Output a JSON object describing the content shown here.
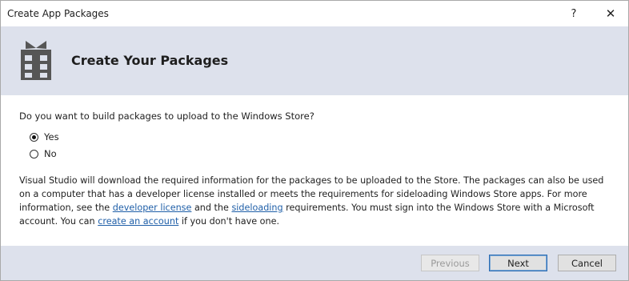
{
  "window": {
    "title": "Create App Packages",
    "help_label": "?",
    "close_label": "✕"
  },
  "header": {
    "title": "Create Your Packages",
    "icon": "package-gift-icon"
  },
  "question": {
    "text": "Do you want to build packages to upload to the Windows Store?",
    "options": [
      {
        "label": "Yes",
        "selected": true
      },
      {
        "label": "No",
        "selected": false
      }
    ]
  },
  "info": {
    "part1": "Visual Studio will download the required information for the packages to be uploaded to the Store. The packages can also be used on a computer that has a developer license installed or meets the requirements for sideloading Windows Store apps. For more information, see the ",
    "link_developer_license": "developer license",
    "part2": " and the ",
    "link_sideloading": "sideloading",
    "part3": " requirements. You must sign into the Windows Store with a Microsoft account. You can ",
    "link_create_account": "create an account",
    "part4": " if you don't have one."
  },
  "footer": {
    "previous_label": "Previous",
    "next_label": "Next",
    "cancel_label": "Cancel"
  },
  "colors": {
    "band": "#dde1ec",
    "link": "#1f5fa8",
    "icon": "#565656"
  }
}
